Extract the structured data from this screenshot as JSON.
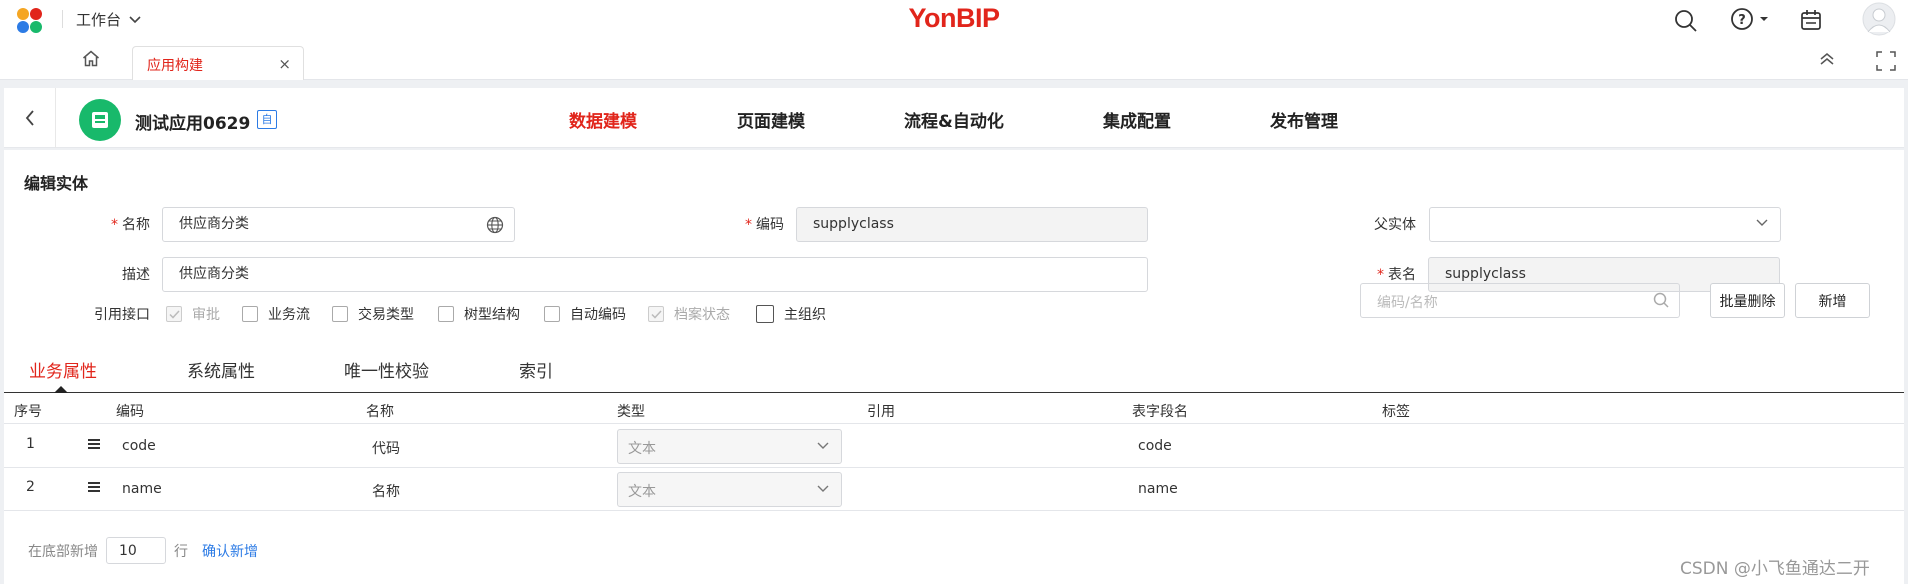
{
  "topbar": {
    "workbench_label": "工作台",
    "brand": "YonBIP"
  },
  "tabs": {
    "active_label": "应用构建",
    "close_glyph": "×"
  },
  "app": {
    "name": "测试应用0629",
    "badge": "自",
    "nav": [
      "数据建模",
      "页面建模",
      "流程&自动化",
      "集成配置",
      "发布管理"
    ],
    "active_nav": "数据建模"
  },
  "form": {
    "title": "编辑实体",
    "name_label": "名称",
    "name_value": "供应商分类",
    "code_label": "编码",
    "code_value": "supplyclass",
    "parent_label": "父实体",
    "parent_value": "",
    "desc_label": "描述",
    "desc_value": "供应商分类",
    "table_label": "表名",
    "table_value": "supplyclass",
    "iface_label": "引用接口",
    "checkboxes": [
      {
        "label": "审批",
        "checked": true,
        "disabled": true
      },
      {
        "label": "业务流",
        "checked": false,
        "disabled": false
      },
      {
        "label": "交易类型",
        "checked": false,
        "disabled": false
      },
      {
        "label": "树型结构",
        "checked": false,
        "disabled": false
      },
      {
        "label": "自动编码",
        "checked": false,
        "disabled": false
      },
      {
        "label": "档案状态",
        "checked": true,
        "disabled": true
      },
      {
        "label": "主组织",
        "checked": false,
        "disabled": false
      }
    ]
  },
  "subtabs": [
    "业务属性",
    "系统属性",
    "唯一性校验",
    "索引"
  ],
  "search": {
    "placeholder": "编码/名称"
  },
  "buttons": {
    "batch_delete": "批量删除",
    "add": "新增"
  },
  "table": {
    "headers": [
      "序号",
      "编码",
      "名称",
      "类型",
      "引用",
      "表字段名",
      "标签"
    ],
    "rows": [
      {
        "index": "1",
        "code": "code",
        "name": "代码",
        "type": "文本",
        "ref": "",
        "field": "code",
        "tag": ""
      },
      {
        "index": "2",
        "code": "name",
        "name": "名称",
        "type": "文本",
        "ref": "",
        "field": "name",
        "tag": ""
      }
    ]
  },
  "footer": {
    "prefix": "在底部新增",
    "count": "10",
    "unit": "行",
    "confirm": "确认新增"
  },
  "watermark": "CSDN @小飞鱼通达二开",
  "colors": {
    "brand_red": "#e1251b",
    "link_blue": "#2c7be5",
    "app_green": "#18b96b"
  }
}
